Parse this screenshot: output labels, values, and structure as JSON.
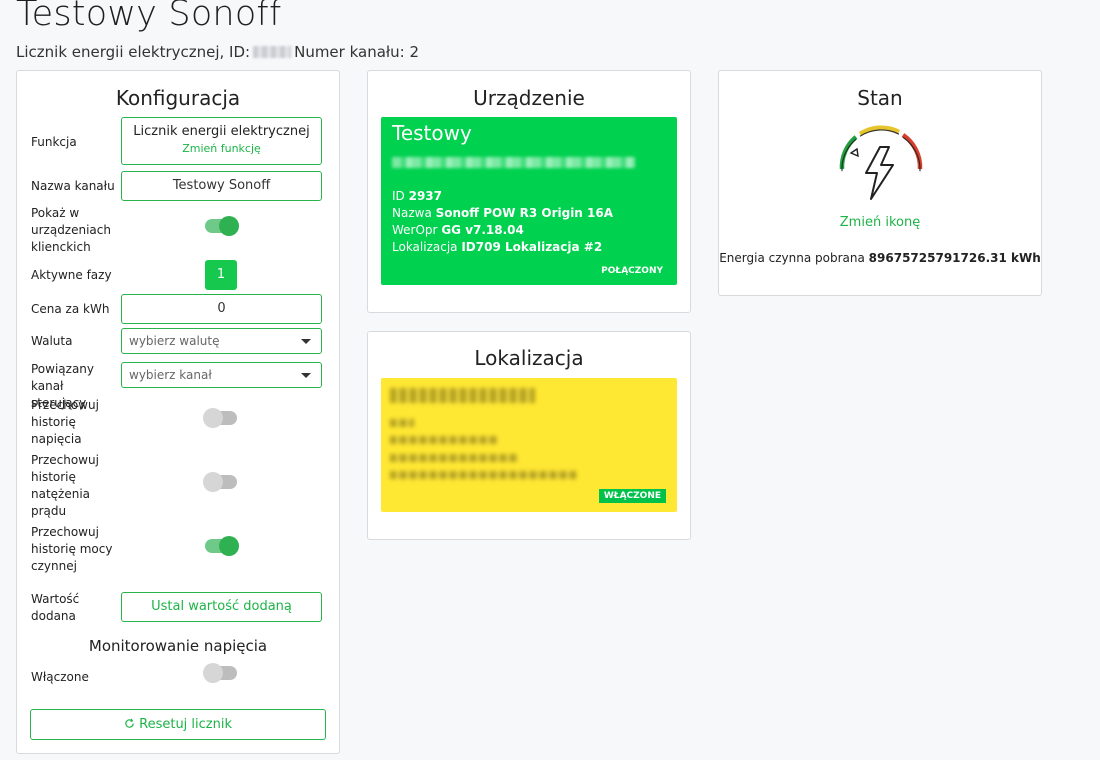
{
  "page": {
    "title": "Testowy Sonoff",
    "subtitle_prefix": "Licznik energii elektrycznej, ID:",
    "subtitle_suffix": "Numer kanału: 2"
  },
  "config": {
    "title": "Konfiguracja",
    "function_label": "Funkcja",
    "function_value": "Licznik energii elektrycznej",
    "function_change": "Zmień funkcję",
    "channel_name_label": "Nazwa kanału",
    "channel_name_value": "Testowy Sonoff",
    "show_in_clients_label": "Pokaż w urządzeniach klienckich",
    "show_in_clients": true,
    "active_phases_label": "Aktywne fazy",
    "active_phase": "1",
    "price_label": "Cena za kWh",
    "price_value": "0",
    "currency_label": "Waluta",
    "currency_placeholder": "wybierz walutę",
    "related_channel_label": "Powiązany kanał sterujący",
    "related_channel_placeholder": "wybierz kanał",
    "store_voltage_label": "Przechowuj historię napięcia",
    "store_voltage": false,
    "store_current_label": "Przechowuj historię natężenia prądu",
    "store_current": false,
    "store_power_label": "Przechowuj historię mocy czynnej",
    "store_power": true,
    "added_value_label": "Wartość dodana",
    "added_value_button": "Ustal wartość dodaną",
    "voltage_monitoring_title": "Monitorowanie napięcia",
    "enabled_label": "Włączone",
    "voltage_monitoring_enabled": false,
    "reset_button": "Resetuj licznik",
    "reset_icon": "reset-icon"
  },
  "device": {
    "title": "Urządzenie",
    "name": "Testowy",
    "id_label": "ID",
    "id_value": "2937",
    "model_label": "Nazwa",
    "model_value": "Sonoff POW R3 Origin 16A",
    "firmware_label": "WerOpr",
    "firmware_value": "GG v7.18.04",
    "location_label": "Lokalizacja",
    "location_value": "ID709 Lokalizacja #2",
    "status": "POŁĄCZONY"
  },
  "location": {
    "title": "Lokalizacja",
    "status": "WŁĄCZONE"
  },
  "state": {
    "title": "Stan",
    "icon": "energy-gauge-icon",
    "change_icon": "Zmień ikonę",
    "energy_label": "Energia czynna pobrana",
    "energy_value": "89675725791726.31 kWh"
  },
  "colors": {
    "accent": "#1db447",
    "device_panel": "#00d14f",
    "location_panel": "#ffe833"
  }
}
